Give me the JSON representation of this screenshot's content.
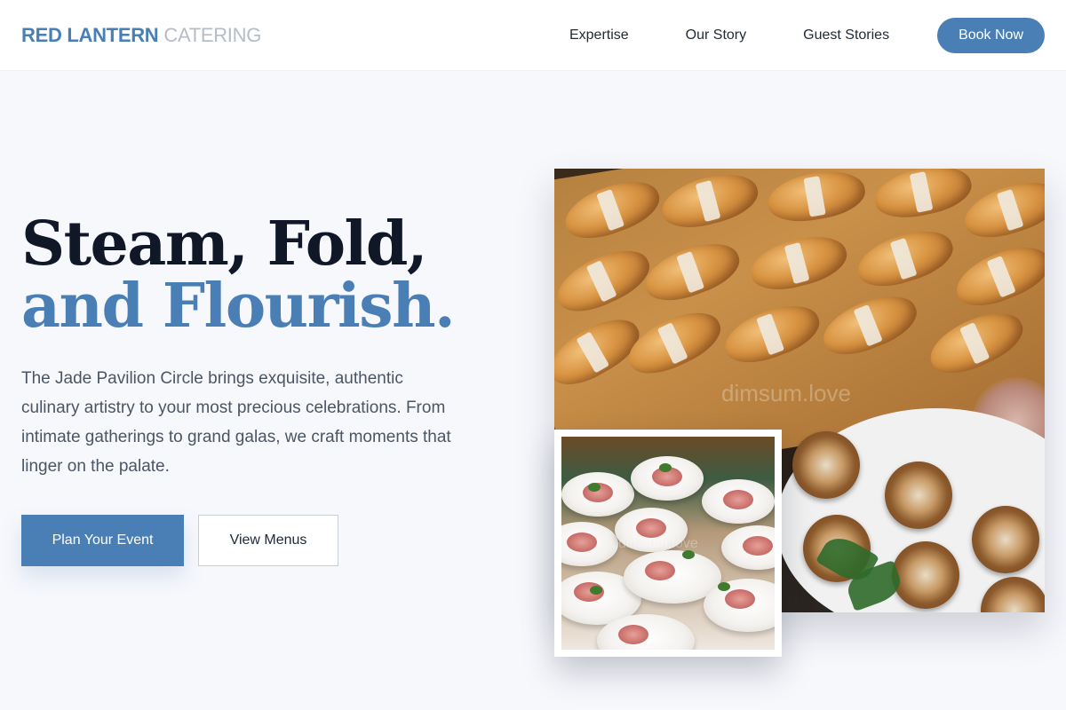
{
  "brand": {
    "name_primary": "RED LANTERN",
    "name_secondary": "CATERING"
  },
  "nav": {
    "links": [
      {
        "label": "Expertise"
      },
      {
        "label": "Our Story"
      },
      {
        "label": "Guest Stories"
      }
    ],
    "book_label": "Book Now"
  },
  "hero": {
    "title_line1": "Steam, Fold,",
    "title_line2": "and Flourish.",
    "description": "The Jade Pavilion Circle brings exquisite, authentic culinary artistry to your most precious celebrations. From intimate gatherings to grand galas, we craft moments that linger on the palate.",
    "primary_cta": "Plan Your Event",
    "secondary_cta": "View Menus"
  },
  "images": {
    "main_watermark": "dimsum.love",
    "inset_watermark": "dimsum.love"
  },
  "colors": {
    "accent": "#4a7fb5",
    "heading": "#101828",
    "background": "#f7f8fc"
  }
}
